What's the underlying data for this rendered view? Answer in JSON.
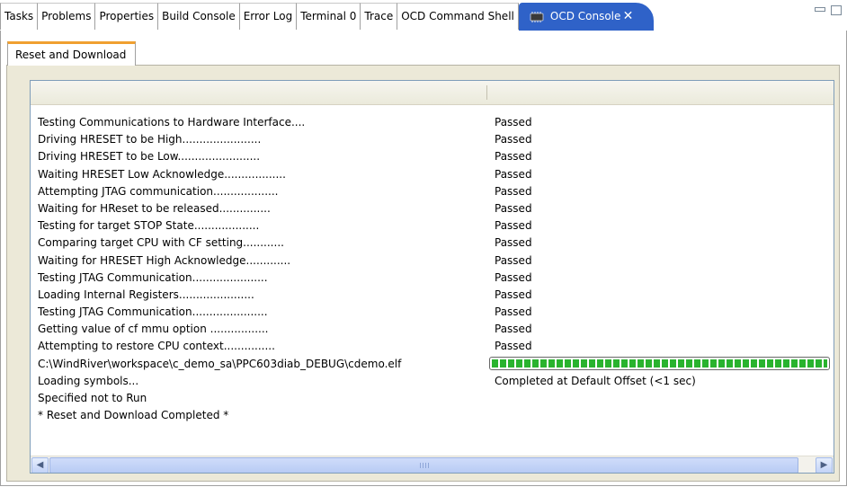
{
  "tabs": [
    {
      "label": "Tasks",
      "active": false
    },
    {
      "label": "Problems",
      "active": false
    },
    {
      "label": "Properties",
      "active": false
    },
    {
      "label": "Build Console",
      "active": false
    },
    {
      "label": "Error Log",
      "active": false
    },
    {
      "label": "Terminal 0",
      "active": false
    },
    {
      "label": "Trace",
      "active": false
    },
    {
      "label": "OCD Command Shell",
      "active": false
    },
    {
      "label": "OCD Console",
      "active": true,
      "icon": "chip-icon"
    }
  ],
  "subtab": {
    "label": "Reset and Download"
  },
  "rows": [
    {
      "step": "Testing Communications to Hardware Interface....",
      "status": "Passed"
    },
    {
      "step": "Driving HRESET to be High.......................",
      "status": "Passed"
    },
    {
      "step": "Driving HRESET to be Low........................",
      "status": "Passed"
    },
    {
      "step": "Waiting HRESET Low Acknowledge..................",
      "status": "Passed"
    },
    {
      "step": "Attempting JTAG communication...................",
      "status": "Passed"
    },
    {
      "step": "Waiting for HReset to be released...............",
      "status": "Passed"
    },
    {
      "step": "Testing for target STOP State...................",
      "status": "Passed"
    },
    {
      "step": "Comparing target CPU with CF setting............",
      "status": "Passed"
    },
    {
      "step": "Waiting for HRESET High Acknowledge.............",
      "status": "Passed"
    },
    {
      "step": "Testing JTAG Communication......................",
      "status": "Passed"
    },
    {
      "step": "Loading Internal Registers......................",
      "status": "Passed"
    },
    {
      "step": "Testing JTAG Communication......................",
      "status": "Passed"
    },
    {
      "step": "Getting value of cf mmu option .................",
      "status": "Passed"
    },
    {
      "step": "Attempting to restore CPU context...............",
      "status": "Passed"
    },
    {
      "step": "C:\\WindRiver\\workspace\\c_demo_sa\\PPC603diab_DEBUG\\cdemo.elf",
      "progress": 1.0
    },
    {
      "step": "Loading symbols...",
      "status": "Completed at Default Offset (<1 sec)"
    },
    {
      "step": "Specified not to Run",
      "status": ""
    },
    {
      "step": "* Reset and Download Completed *",
      "status": ""
    }
  ],
  "colors": {
    "active_tab": "#2f62c8",
    "progress": "#29b32e",
    "subtab_accent": "#f0a030"
  },
  "icons": [
    "chip-icon",
    "close-icon",
    "minimize-icon",
    "maximize-icon",
    "scroll-left-icon",
    "scroll-right-icon"
  ]
}
